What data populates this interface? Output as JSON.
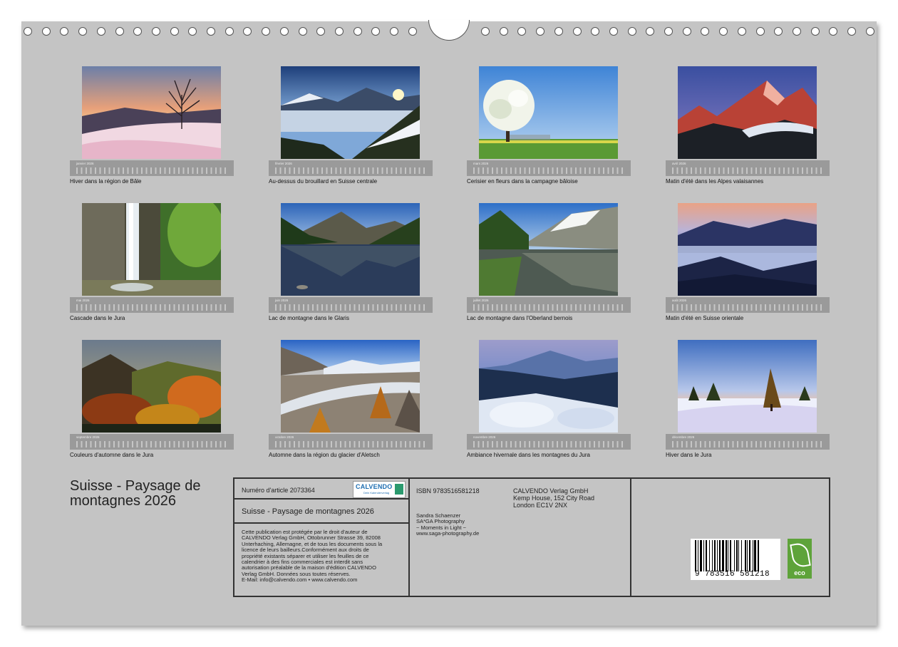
{
  "months": [
    {
      "id": "janvier",
      "label": "janvier 2026",
      "caption": "Hiver dans la région de Bâle"
    },
    {
      "id": "fevrier",
      "label": "février 2026",
      "caption": "Au-dessus du brouillard en Suisse centrale"
    },
    {
      "id": "mars",
      "label": "mars 2026",
      "caption": "Cerisier en fleurs dans la campagne bâloise"
    },
    {
      "id": "avril",
      "label": "avril 2026",
      "caption": "Matin d'été dans les Alpes valaisannes"
    },
    {
      "id": "mai",
      "label": "mai 2026",
      "caption": "Cascade dans le Jura"
    },
    {
      "id": "juin",
      "label": "juin 2026",
      "caption": "Lac de montagne dans le Glaris"
    },
    {
      "id": "juillet",
      "label": "juillet 2026",
      "caption": "Lac de montagne dans l'Oberland bernois"
    },
    {
      "id": "aout",
      "label": "août 2026",
      "caption": "Matin d'été en Suisse orientale"
    },
    {
      "id": "septembre",
      "label": "septembre 2026",
      "caption": "Couleurs d'automne dans le Jura"
    },
    {
      "id": "octobre",
      "label": "octobre 2026",
      "caption": "Automne dans la région du glacier d'Aletsch"
    },
    {
      "id": "novembre",
      "label": "novembre 2026",
      "caption": "Ambiance hivernale dans les montagnes du Jura"
    },
    {
      "id": "decembre",
      "label": "décembre 2026",
      "caption": "Hiver dans le Jura"
    }
  ],
  "title": "Suisse - Paysage de montagnes 2026",
  "info": {
    "article": "Numéro d'article 2073364",
    "subtitle": "Suisse - Paysage de montagnes 2026",
    "legal": [
      "Cette publication est protégée par le droit d'auteur de",
      "CALVENDO Verlag GmbH, Ottobrunner Strasse 39, 82008",
      "Unterhaching,  Allemagne, et de tous les documents sous la",
      "licence de leurs bailleurs.Conformément aux droits de",
      "propriété existants séparer et utiliser les feuilles de ce",
      "calendrier à des fins commerciales est interdit sans",
      "autorisation préalable de la maison d'édition  CALVENDO",
      "Verlag GmbH. Données sous toutes réserves.",
      "E-Mail: info@calvendo.com • www.calvendo.com"
    ],
    "isbn": "ISBN 9783516581218",
    "publisher": [
      "CALVENDO Verlag GmbH",
      "Kemp House, 152 City Road",
      "London EC1V 2NX"
    ],
    "author": [
      "Sandra Schaenzer",
      "SA*GA Photography",
      "~ Moments in Light ~",
      "www.saga-photography.de"
    ],
    "logo_text": "CALVENDO",
    "logo_sub": "Dein Kalenderverlag",
    "barcode_digits": "9   783516   581218",
    "eco_label": "eco"
  },
  "colors": {
    "sheet": "#c4c4c4",
    "calbar": "#9a9a9a",
    "eco": "#5ea33a",
    "logo": "#1f6fb2"
  }
}
